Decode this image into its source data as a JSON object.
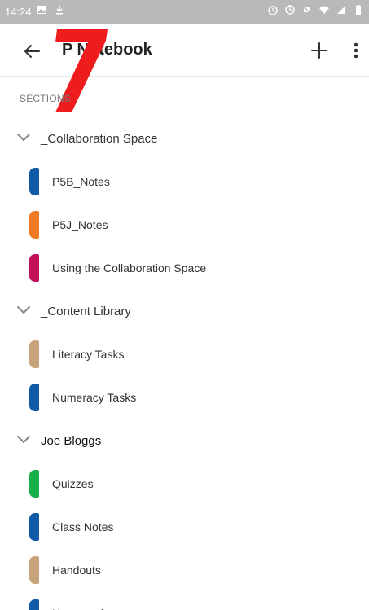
{
  "status_bar": {
    "time": "14:24",
    "bg_color": "#b9b9b9"
  },
  "app_bar": {
    "title": "P Notebook",
    "back_icon": "arrow-left-icon",
    "add_icon": "plus-icon",
    "more_icon": "more-vertical-icon"
  },
  "annotation": {
    "text": "7",
    "color": "#ee1c1c"
  },
  "sections_label": "SECTIONS",
  "groups": [
    {
      "label": "_Collaboration Space",
      "sections": [
        {
          "label": "P5B_Notes",
          "color": "#0e5aa7"
        },
        {
          "label": "P5J_Notes",
          "color": "#f07a23"
        },
        {
          "label": "Using the Collaboration Space",
          "color": "#c4105a"
        }
      ]
    },
    {
      "label": "_Content Library",
      "sections": [
        {
          "label": "Literacy Tasks",
          "color": "#c9a37c"
        },
        {
          "label": "Numeracy Tasks",
          "color": "#0e5aa7"
        }
      ]
    },
    {
      "label": "Joe Bloggs",
      "sections": [
        {
          "label": "Quizzes",
          "color": "#18b04a"
        },
        {
          "label": "Class Notes",
          "color": "#0e5aa7"
        },
        {
          "label": "Handouts",
          "color": "#c9a37c"
        },
        {
          "label": "Homework",
          "color": "#0e5aa7"
        }
      ]
    }
  ]
}
